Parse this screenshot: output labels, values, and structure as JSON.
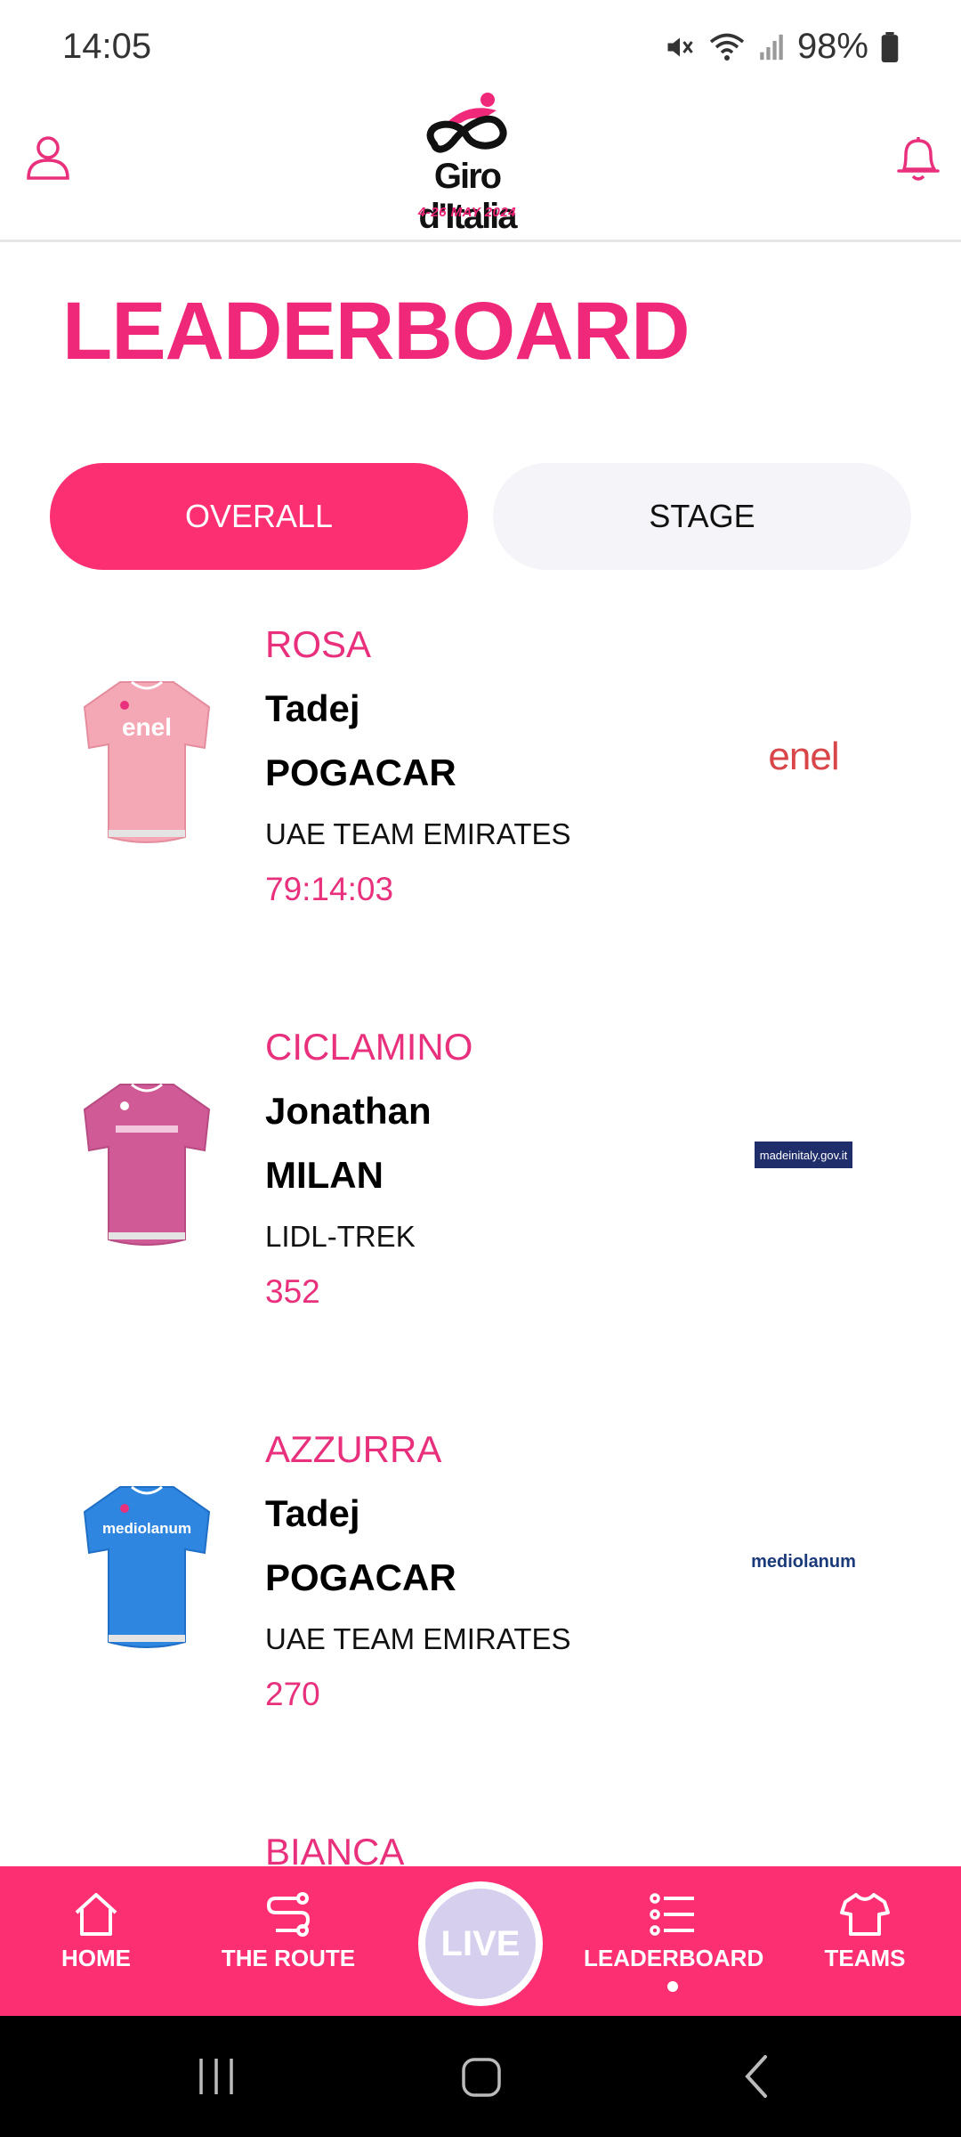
{
  "status": {
    "time": "14:05",
    "battery": "98%"
  },
  "header": {
    "logo_text": "Giro d'Italia",
    "logo_dates": "4-26 MAY 2024"
  },
  "page": {
    "title": "LEADERBOARD"
  },
  "tabs": {
    "overall": "OVERALL",
    "stage": "STAGE",
    "active": "overall"
  },
  "entries": [
    {
      "category": "ROSA",
      "first_name": "Tadej",
      "last_name": "POGACAR",
      "team": "UAE TEAM EMIRATES",
      "value": "79:14:03",
      "jersey_color": "#f4a7b5",
      "sponsor": "enel"
    },
    {
      "category": "CICLAMINO",
      "first_name": "Jonathan",
      "last_name": "MILAN",
      "team": "LIDL-TREK",
      "value": "352",
      "jersey_color": "#cf5a96",
      "sponsor": "madeinitaly.gov.it"
    },
    {
      "category": "AZZURRA",
      "first_name": "Tadej",
      "last_name": "POGACAR",
      "team": "UAE TEAM EMIRATES",
      "value": "270",
      "jersey_color": "#2f86e0",
      "sponsor": "mediolanum"
    },
    {
      "category": "BIANCA"
    }
  ],
  "nav": {
    "home": "HOME",
    "route": "THE ROUTE",
    "live": "LIVE",
    "leaderboard": "LEADERBOARD",
    "teams": "TEAMS",
    "active": "leaderboard"
  },
  "colors": {
    "accent": "#fd2f73",
    "accent_text": "#e8307c",
    "tab_inactive": "#f5f5f9"
  }
}
